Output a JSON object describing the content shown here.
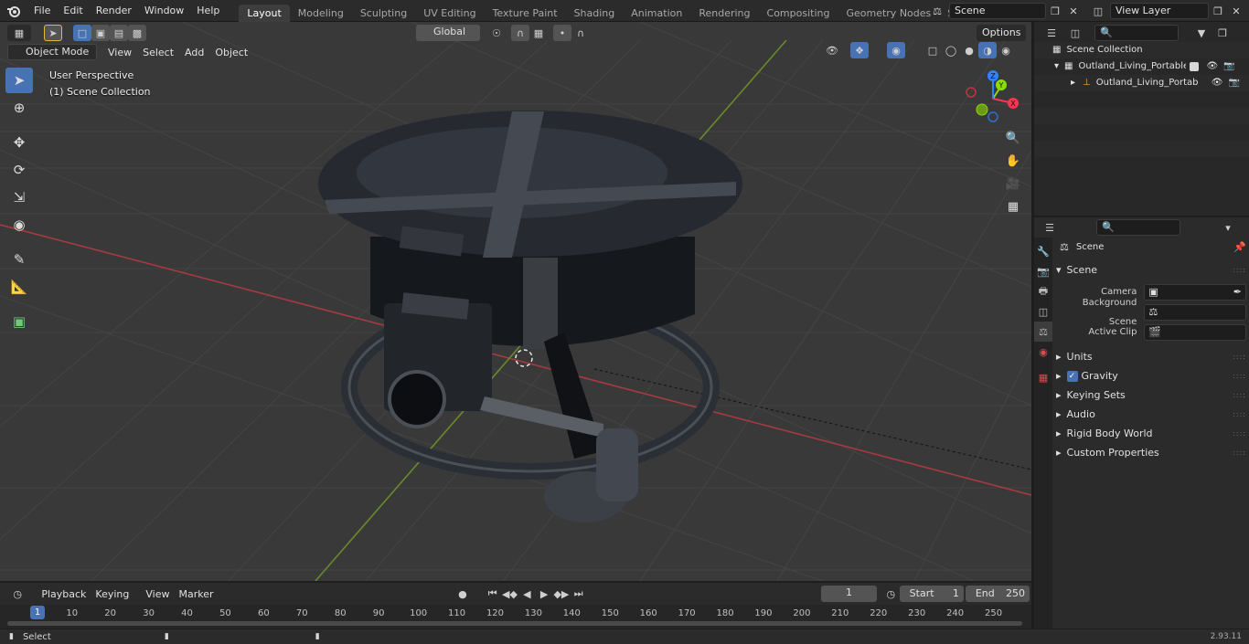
{
  "menubar": {
    "items": [
      "File",
      "Edit",
      "Render",
      "Window",
      "Help"
    ],
    "workspaces": [
      "Layout",
      "Modeling",
      "Sculpting",
      "UV Editing",
      "Texture Paint",
      "Shading",
      "Animation",
      "Rendering",
      "Compositing",
      "Geometry Nodes",
      "Scripting"
    ],
    "add_tab": "+",
    "scene_name": "Scene",
    "view_layer": "View Layer"
  },
  "viewport": {
    "mode": "Object Mode",
    "menus": [
      "View",
      "Select",
      "Add",
      "Object"
    ],
    "transform_orientation": "Global",
    "options_label": "Options",
    "perspective_text": "User Perspective",
    "collection_text": "(1) Scene Collection",
    "gizmo_axes": {
      "x": "X",
      "y": "Y",
      "z": "Z"
    },
    "colors": {
      "x_axis": "#ff3352",
      "y_axis": "#8bdc00",
      "z_axis": "#2f83ff",
      "grid": "#424242",
      "background": "#393939"
    }
  },
  "outliner": {
    "root": "Scene Collection",
    "items": [
      {
        "label": "Outland_Living_Portable_Prop",
        "level": 1
      },
      {
        "label": "Outland_Living_Portable_",
        "level": 2
      }
    ]
  },
  "properties": {
    "context_title": "Scene",
    "section": "Scene",
    "fields": [
      {
        "label": "Camera"
      },
      {
        "label": "Background Scene"
      },
      {
        "label": "Active Clip"
      }
    ],
    "panels": [
      "Units",
      "Gravity",
      "Keying Sets",
      "Audio",
      "Rigid Body World",
      "Custom Properties"
    ],
    "gravity_checked": true
  },
  "timeline": {
    "menus": [
      "Playback",
      "Keying",
      "View",
      "Marker"
    ],
    "current_frame": "1",
    "start_label": "Start",
    "start_value": "1",
    "end_label": "End",
    "end_value": "250",
    "ruler": [
      "1",
      "10",
      "20",
      "30",
      "40",
      "50",
      "60",
      "70",
      "80",
      "90",
      "100",
      "110",
      "120",
      "130",
      "140",
      "150",
      "160",
      "170",
      "180",
      "190",
      "200",
      "210",
      "220",
      "230",
      "240",
      "250"
    ],
    "accent": "#4772b3"
  },
  "statusbar": {
    "select_label": "Select",
    "version": "2.93.11"
  }
}
